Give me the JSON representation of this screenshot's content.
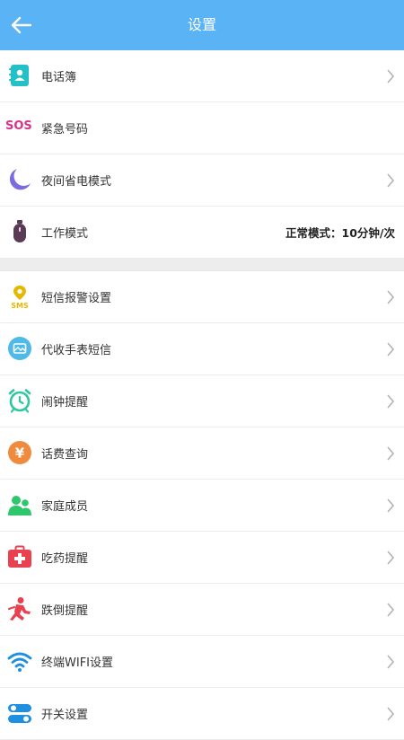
{
  "header": {
    "title": "设置"
  },
  "section1": [
    {
      "label": "电话簿"
    },
    {
      "label": "紧急号码",
      "icon_text": "SOS"
    },
    {
      "label": "夜间省电模式"
    },
    {
      "label": "工作模式",
      "value": "正常模式：10分钟/次"
    }
  ],
  "section2": [
    {
      "label": "短信报警设置",
      "icon_text": "SMS"
    },
    {
      "label": "代收手表短信"
    },
    {
      "label": "闹钟提醒"
    },
    {
      "label": "话费查询",
      "icon_text": "¥"
    },
    {
      "label": "家庭成员"
    },
    {
      "label": "吃药提醒"
    },
    {
      "label": "跌倒提醒"
    },
    {
      "label": "终端WIFI设置"
    },
    {
      "label": "开关设置"
    }
  ],
  "colors": {
    "header_bg": "#5ab3f5",
    "phonebook": "#23c1c7",
    "sos": "#d6338a",
    "night": "#7b6be0",
    "sms": "#e6b800",
    "message": "#4fb9e8",
    "alarm": "#2fc7a0",
    "fee": "#f08a3c",
    "family": "#2fc76c",
    "medicine": "#e94150",
    "fall": "#e94150",
    "wifi": "#1f8fe0",
    "switch": "#1f8fe0"
  }
}
